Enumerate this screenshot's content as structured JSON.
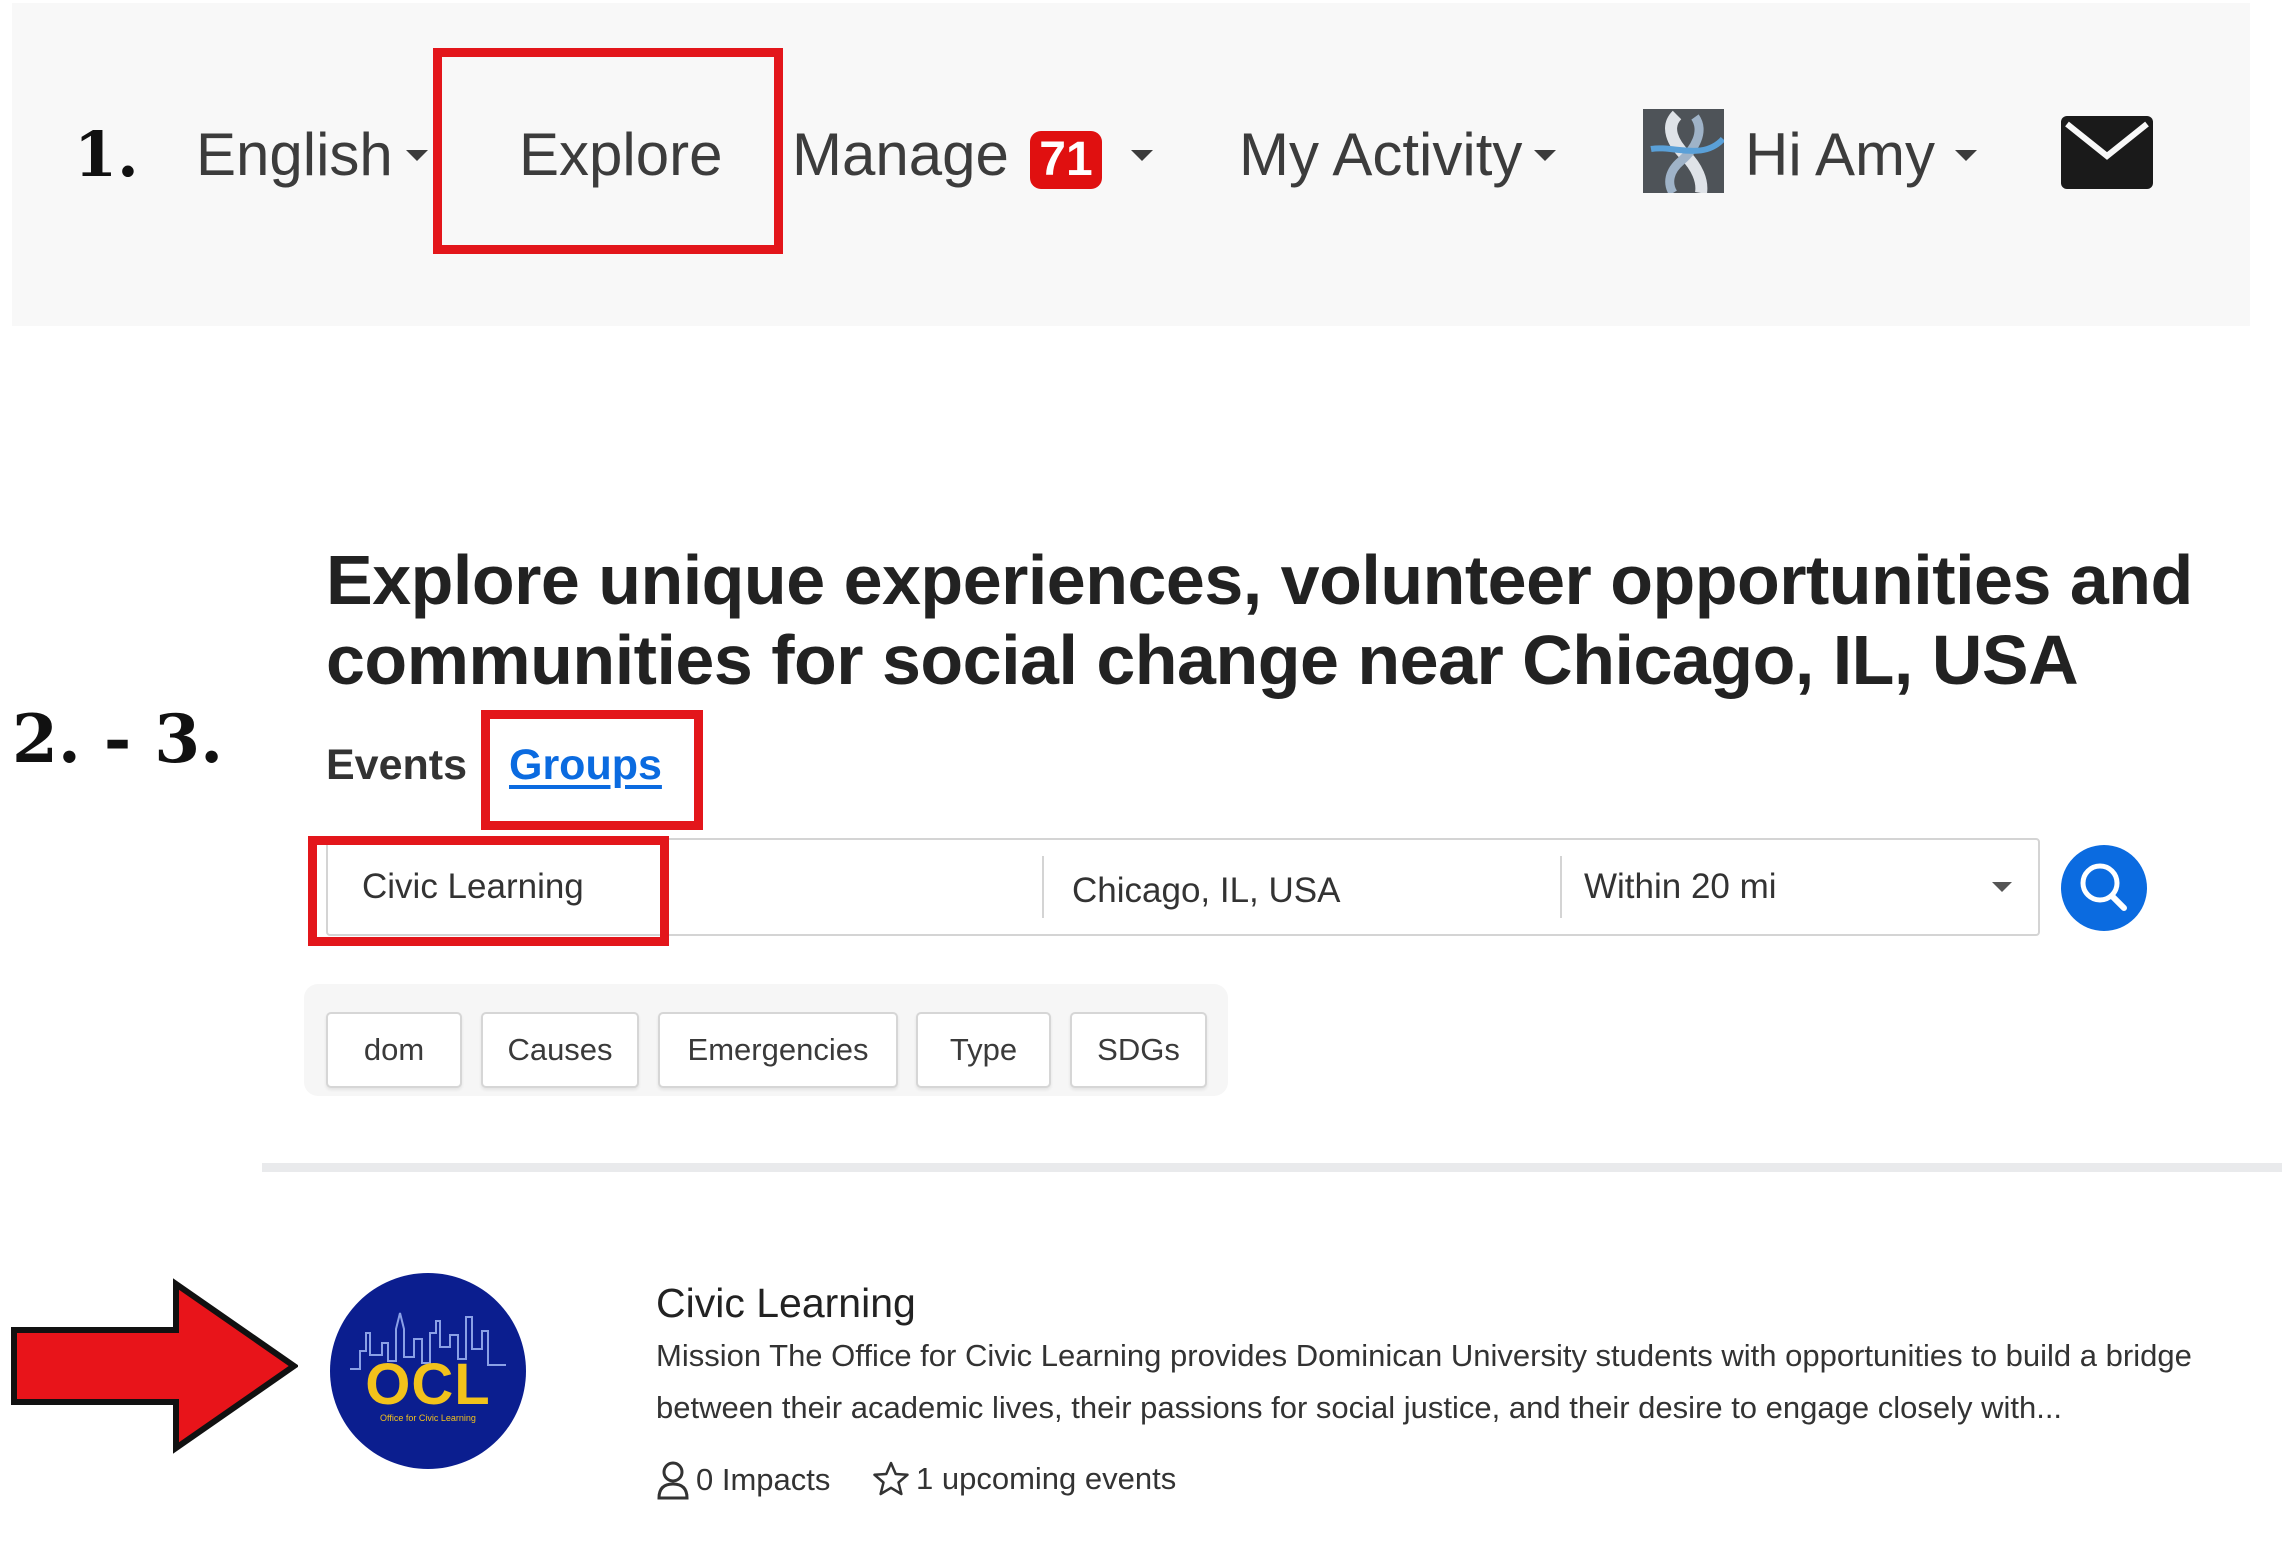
{
  "annotations": {
    "step1": "1.",
    "step2_3": "2. - 3."
  },
  "navbar": {
    "language": "English",
    "explore": "Explore",
    "manage": "Manage",
    "manage_badge": "71",
    "my_activity": "My Activity",
    "greeting": "Hi Amy",
    "mail_icon": "envelope-icon"
  },
  "explore": {
    "heading": "Explore unique experiences, volunteer opportunities and communities for social change near Chicago, IL, USA",
    "tabs": [
      "Events",
      "Groups"
    ],
    "search": {
      "keyword_value": "Civic Learning",
      "location_value": "Chicago, IL, USA",
      "distance": "Within 20 mi",
      "search_icon": "search-icon"
    },
    "filters": [
      "dom",
      "Causes",
      "Emergencies",
      "Type",
      "SDGs"
    ]
  },
  "result": {
    "logo_text": "OCL",
    "logo_subtext": "Office for Civic Learning",
    "title": "Civic Learning",
    "description": "Mission The Office for Civic Learning provides Dominican University students with opportunities to build a bridge between their academic lives, their passions for social justice, and their desire to engage closely with...",
    "impacts": "0 Impacts",
    "upcoming_events": "1 upcoming events"
  },
  "colors": {
    "highlight_red": "#e3161b",
    "link_blue": "#0b6be0",
    "badge_red": "#e01010",
    "logo_navy": "#0b1e8f",
    "logo_gold": "#f2c21b"
  }
}
